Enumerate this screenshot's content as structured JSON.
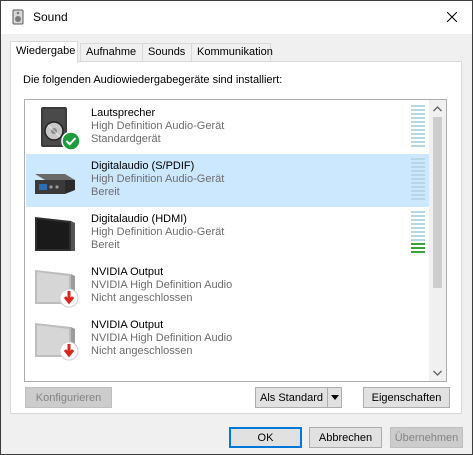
{
  "window": {
    "title": "Sound",
    "icon": "speaker-app-icon",
    "close": "close-icon"
  },
  "tabs": [
    {
      "label": "Wiedergabe",
      "active": true
    },
    {
      "label": "Aufnahme",
      "active": false
    },
    {
      "label": "Sounds",
      "active": false
    },
    {
      "label": "Kommunikation",
      "active": false
    }
  ],
  "panel": {
    "description": "Die folgenden Audiowiedergabegeräte sind installiert:"
  },
  "devices": [
    {
      "name": "Lautsprecher",
      "driver": "High Definition Audio-Gerät",
      "status": "Standardgerät",
      "icon": "speaker-icon",
      "badge": "default-check-icon",
      "selected": false,
      "level": 0
    },
    {
      "name": "Digitalaudio (S/PDIF)",
      "driver": "High Definition Audio-Gerät",
      "status": "Bereit",
      "icon": "digital-audio-icon",
      "selected": true,
      "level": 0
    },
    {
      "name": "Digitalaudio (HDMI)",
      "driver": "High Definition Audio-Gerät",
      "status": "Bereit",
      "icon": "monitor-icon",
      "selected": false,
      "level": 0.3
    },
    {
      "name": "NVIDIA Output",
      "driver": "NVIDIA High Definition Audio",
      "status": "Nicht angeschlossen",
      "icon": "monitor-disconnected-icon",
      "badge": "unplugged-icon",
      "selected": false
    },
    {
      "name": "NVIDIA Output",
      "driver": "NVIDIA High Definition Audio",
      "status": "Nicht angeschlossen",
      "icon": "monitor-disconnected-icon",
      "badge": "unplugged-icon",
      "selected": false
    }
  ],
  "buttons": {
    "configure": "Konfigurieren",
    "set_default": "Als Standard",
    "properties": "Eigenschaften",
    "ok": "OK",
    "cancel": "Abbrechen",
    "apply": "Übernehmen"
  },
  "colors": {
    "selection": "#cce8ff",
    "accent": "#0078d7",
    "meter": "#b6d6e6",
    "meter_active": "#39a339",
    "check": "#1d9b3d",
    "unplugged": "#d9261c"
  }
}
